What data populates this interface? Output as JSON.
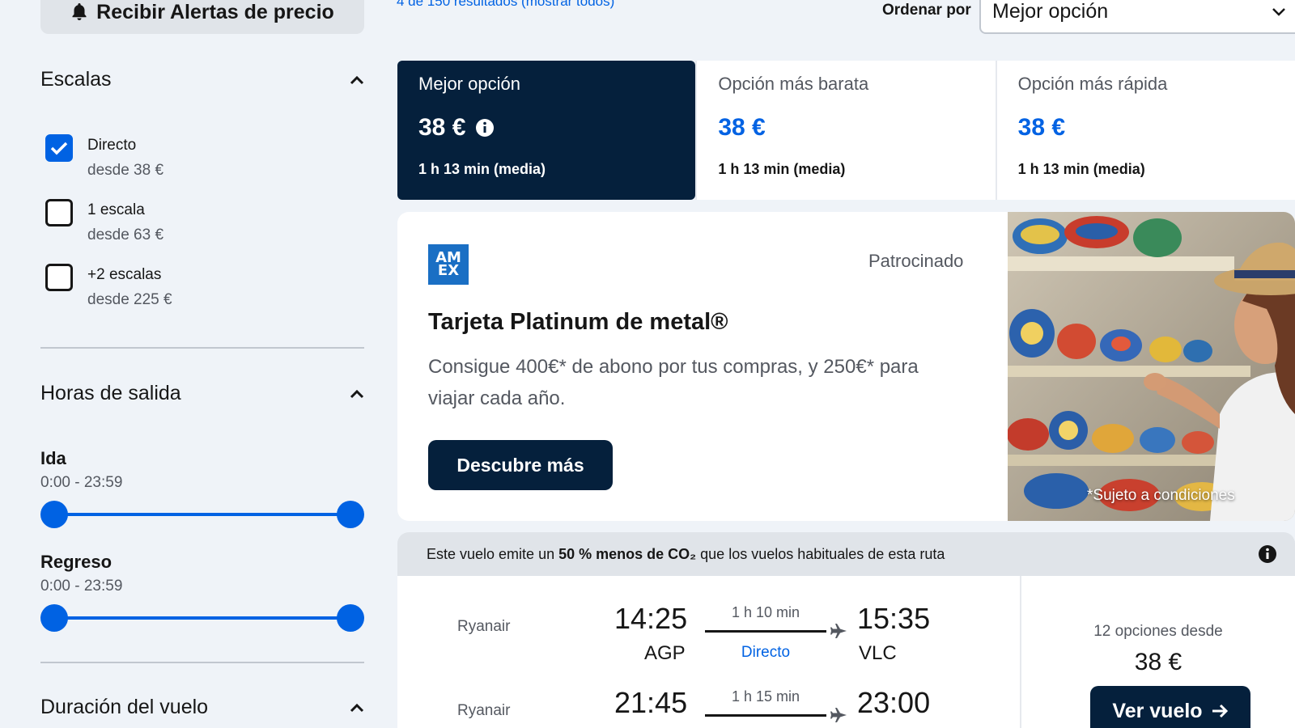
{
  "sidebar": {
    "alert_button": "Recibir Alertas de precio",
    "stops": {
      "title": "Escalas",
      "options": [
        {
          "label": "Directo",
          "sub": "desde 38 €",
          "checked": true
        },
        {
          "label": "1 escala",
          "sub": "desde 63 €",
          "checked": false
        },
        {
          "label": "+2 escalas",
          "sub": "desde 225 €",
          "checked": false
        }
      ]
    },
    "departure": {
      "title": "Horas de salida",
      "outbound": {
        "label": "Ida",
        "range": "0:00 - 23:59"
      },
      "return": {
        "label": "Regreso",
        "range": "0:00 - 23:59"
      }
    },
    "duration": {
      "title": "Duración del vuelo"
    }
  },
  "topbar": {
    "results": "4 de 150 resultados (mostrar todos)",
    "sort_label": "Ordenar por",
    "sort_value": "Mejor opción"
  },
  "tabs": [
    {
      "label": "Mejor opción",
      "price": "38 €",
      "time": "1 h 13 min (media)",
      "active": true
    },
    {
      "label": "Opción más barata",
      "price": "38 €",
      "time": "1 h 13 min (media)",
      "active": false
    },
    {
      "label": "Opción más rápida",
      "price": "38 €",
      "time": "1 h 13 min (media)",
      "active": false
    }
  ],
  "ad": {
    "logo_top": "AM",
    "logo_bottom": "EX",
    "sponsored": "Patrocinado",
    "title": "Tarjeta Platinum de metal®",
    "description": "Consigue 400€* de abono por tus compras, y 250€* para viajar cada año.",
    "cta": "Descubre más",
    "caption": "*Sujeto a condiciones"
  },
  "eco": {
    "prefix": "Este vuelo emite un",
    "highlight": "50 % menos de CO₂",
    "suffix": "que los vuelos habituales de esta ruta"
  },
  "flight": {
    "legs": [
      {
        "airline": "Ryanair",
        "dep_time": "14:25",
        "dep_code": "AGP",
        "duration": "1 h 10 min",
        "stops": "Directo",
        "arr_time": "15:35",
        "arr_code": "VLC"
      },
      {
        "airline": "Ryanair",
        "dep_time": "21:45",
        "dep_code": "",
        "duration": "1 h 15 min",
        "stops": "",
        "arr_time": "23:00",
        "arr_code": ""
      }
    ],
    "options_text": "12 opciones desde",
    "price": "38 €",
    "view_button": "Ver vuelo"
  },
  "colors": {
    "accent": "#0062e3",
    "navy": "#05203c",
    "background": "#eff3f8"
  }
}
